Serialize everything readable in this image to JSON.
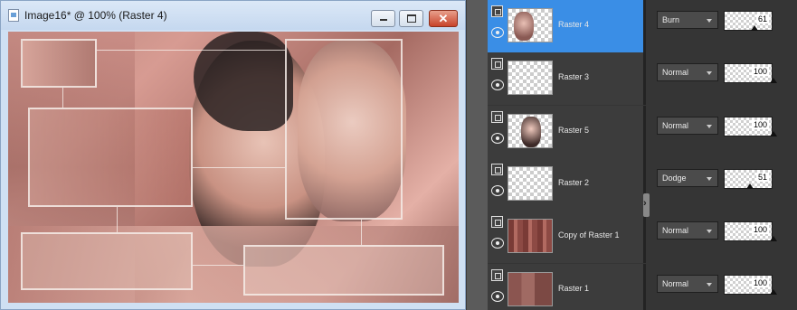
{
  "window": {
    "title": "Image16* @ 100% (Raster 4)",
    "buttons": {
      "minimize": "minimize",
      "maximize": "maximize",
      "close": "✕"
    }
  },
  "layers": [
    {
      "name": "Raster 4",
      "blend": "Burn",
      "opacity": "61",
      "selected": true,
      "thumb": "faces"
    },
    {
      "name": "Raster 3",
      "blend": "Normal",
      "opacity": "100",
      "selected": false,
      "thumb": "empty"
    },
    {
      "name": "Raster 5",
      "blend": "Normal",
      "opacity": "100",
      "selected": false,
      "thumb": "faces-small"
    },
    {
      "name": "Raster 2",
      "blend": "Dodge",
      "opacity": "51",
      "selected": false,
      "thumb": "empty"
    },
    {
      "name": "Copy of Raster 1",
      "blend": "Normal",
      "opacity": "100",
      "selected": false,
      "thumb": "texture"
    },
    {
      "name": "Raster 1",
      "blend": "Normal",
      "opacity": "100",
      "selected": false,
      "thumb": "blocks"
    }
  ],
  "colors": {
    "selected_row": "#3a8ee6",
    "panel_bg": "#353535",
    "canvas_accent": "#c98a82"
  }
}
